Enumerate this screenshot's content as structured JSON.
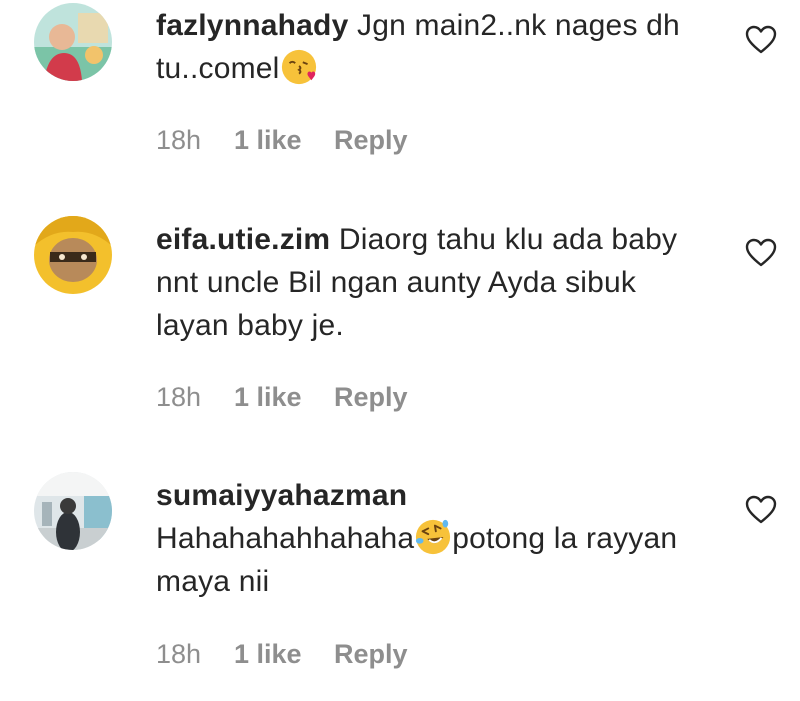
{
  "comments": [
    {
      "username": "fazlynnahady",
      "text_before_emoji": "Jgn main2..nk nages dh tu..comel",
      "emoji": "face-blowing-kiss-emoji",
      "text_after_emoji": "",
      "time": "18h",
      "likes": "1 like",
      "reply": "Reply"
    },
    {
      "username": "eifa.utie.zim",
      "text_before_emoji": "Diaorg tahu klu ada baby nnt uncle Bil ngan aunty Ayda sibuk layan baby je.",
      "time": "18h",
      "likes": "1 like",
      "reply": "Reply"
    },
    {
      "username": "sumaiyyahazman",
      "text_before_emoji": "Hahahahahhahaha",
      "emoji": "rolling-on-floor-laughing-emoji",
      "text_after_emoji": "potong la rayyan maya nii",
      "time": "18h",
      "likes": "1 like",
      "reply": "Reply"
    }
  ],
  "icons": {
    "like": "heart-outline-icon"
  },
  "colors": {
    "text": "#262626",
    "meta": "#8e8e8e",
    "emoji_yellow": "#f7c23a",
    "emoji_kiss_heart": "#e0245e"
  }
}
